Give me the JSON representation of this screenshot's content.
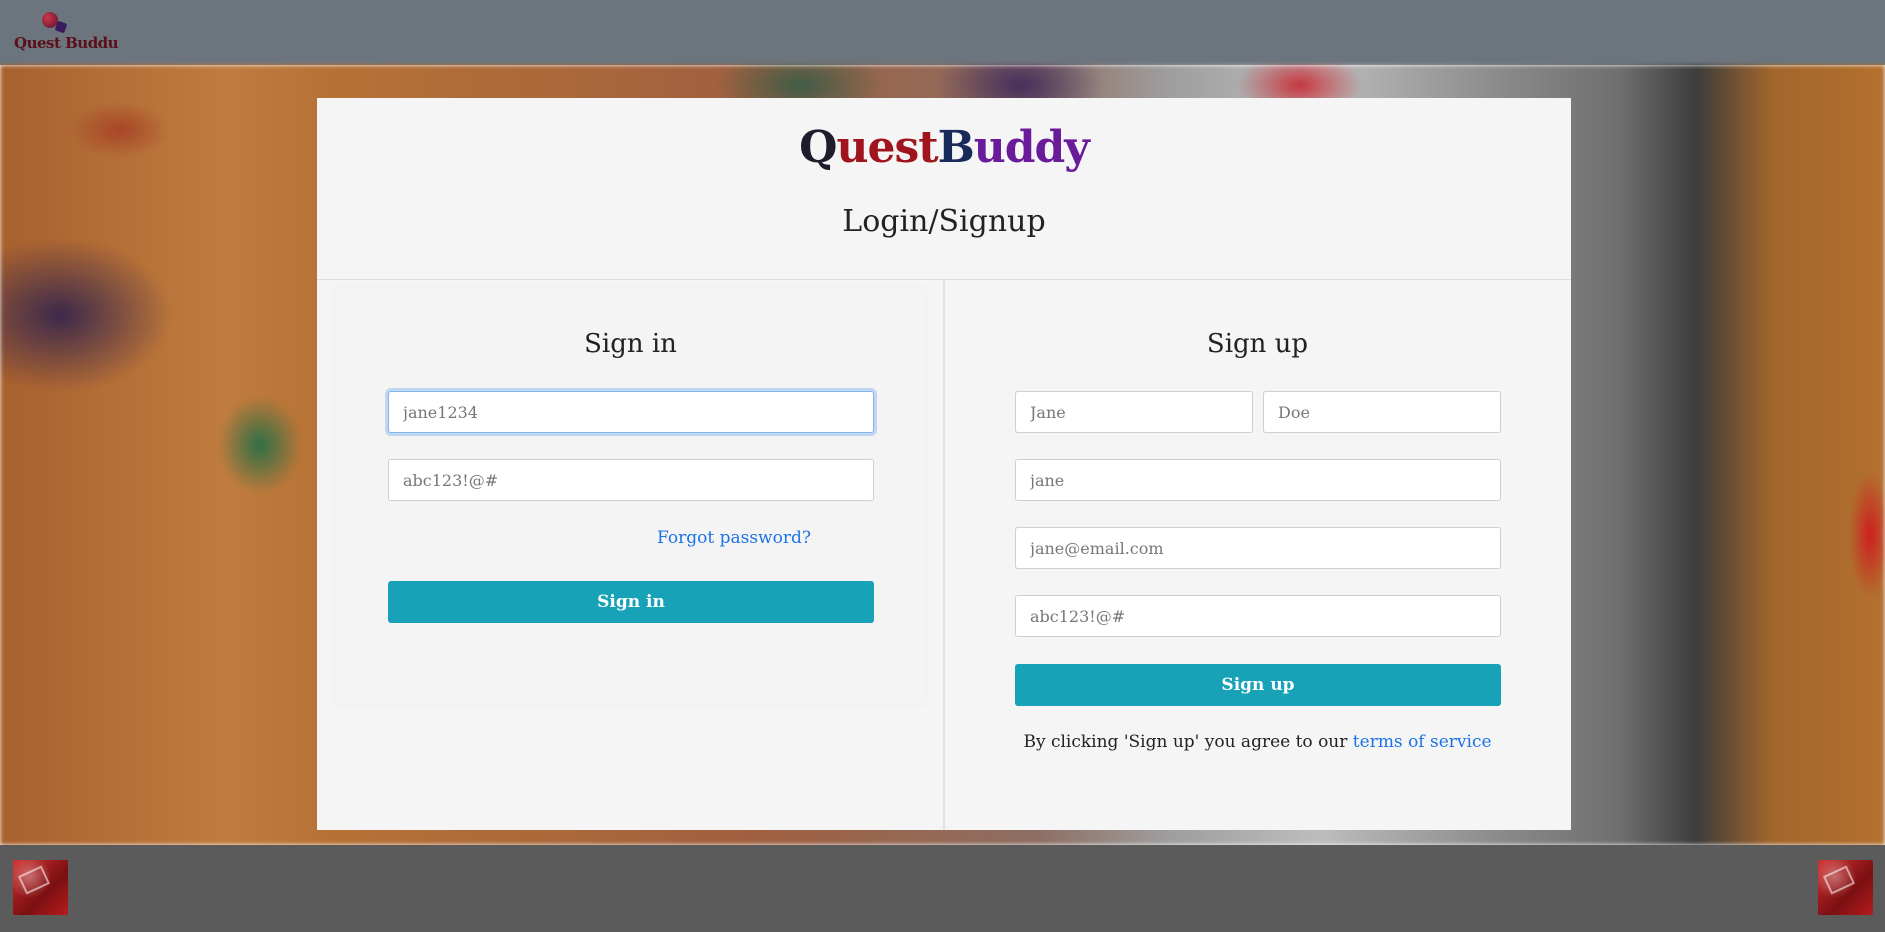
{
  "navbar": {
    "brand_text": "Quest Buddu"
  },
  "card": {
    "logo": {
      "q": "Q",
      "uest": "uest",
      "b": "B",
      "uddy": "uddy"
    },
    "title": "Login/Signup"
  },
  "signin": {
    "heading": "Sign in",
    "username_placeholder": "jane1234",
    "password_placeholder": "abc123!@#",
    "forgot_link": "Forgot password?",
    "button": "Sign in"
  },
  "signup": {
    "heading": "Sign up",
    "first_name_placeholder": "Jane",
    "last_name_placeholder": "Doe",
    "username_placeholder": "jane",
    "email_placeholder": "jane@email.com",
    "password_placeholder": "abc123!@#",
    "button": "Sign up",
    "terms_prefix": "By clicking 'Sign up' you agree to our ",
    "terms_link": "terms of service"
  },
  "colors": {
    "navbar": "#6c757d",
    "footer": "#5b5b5b",
    "primary_button": "#17a2b8",
    "link": "#1a73e8"
  }
}
